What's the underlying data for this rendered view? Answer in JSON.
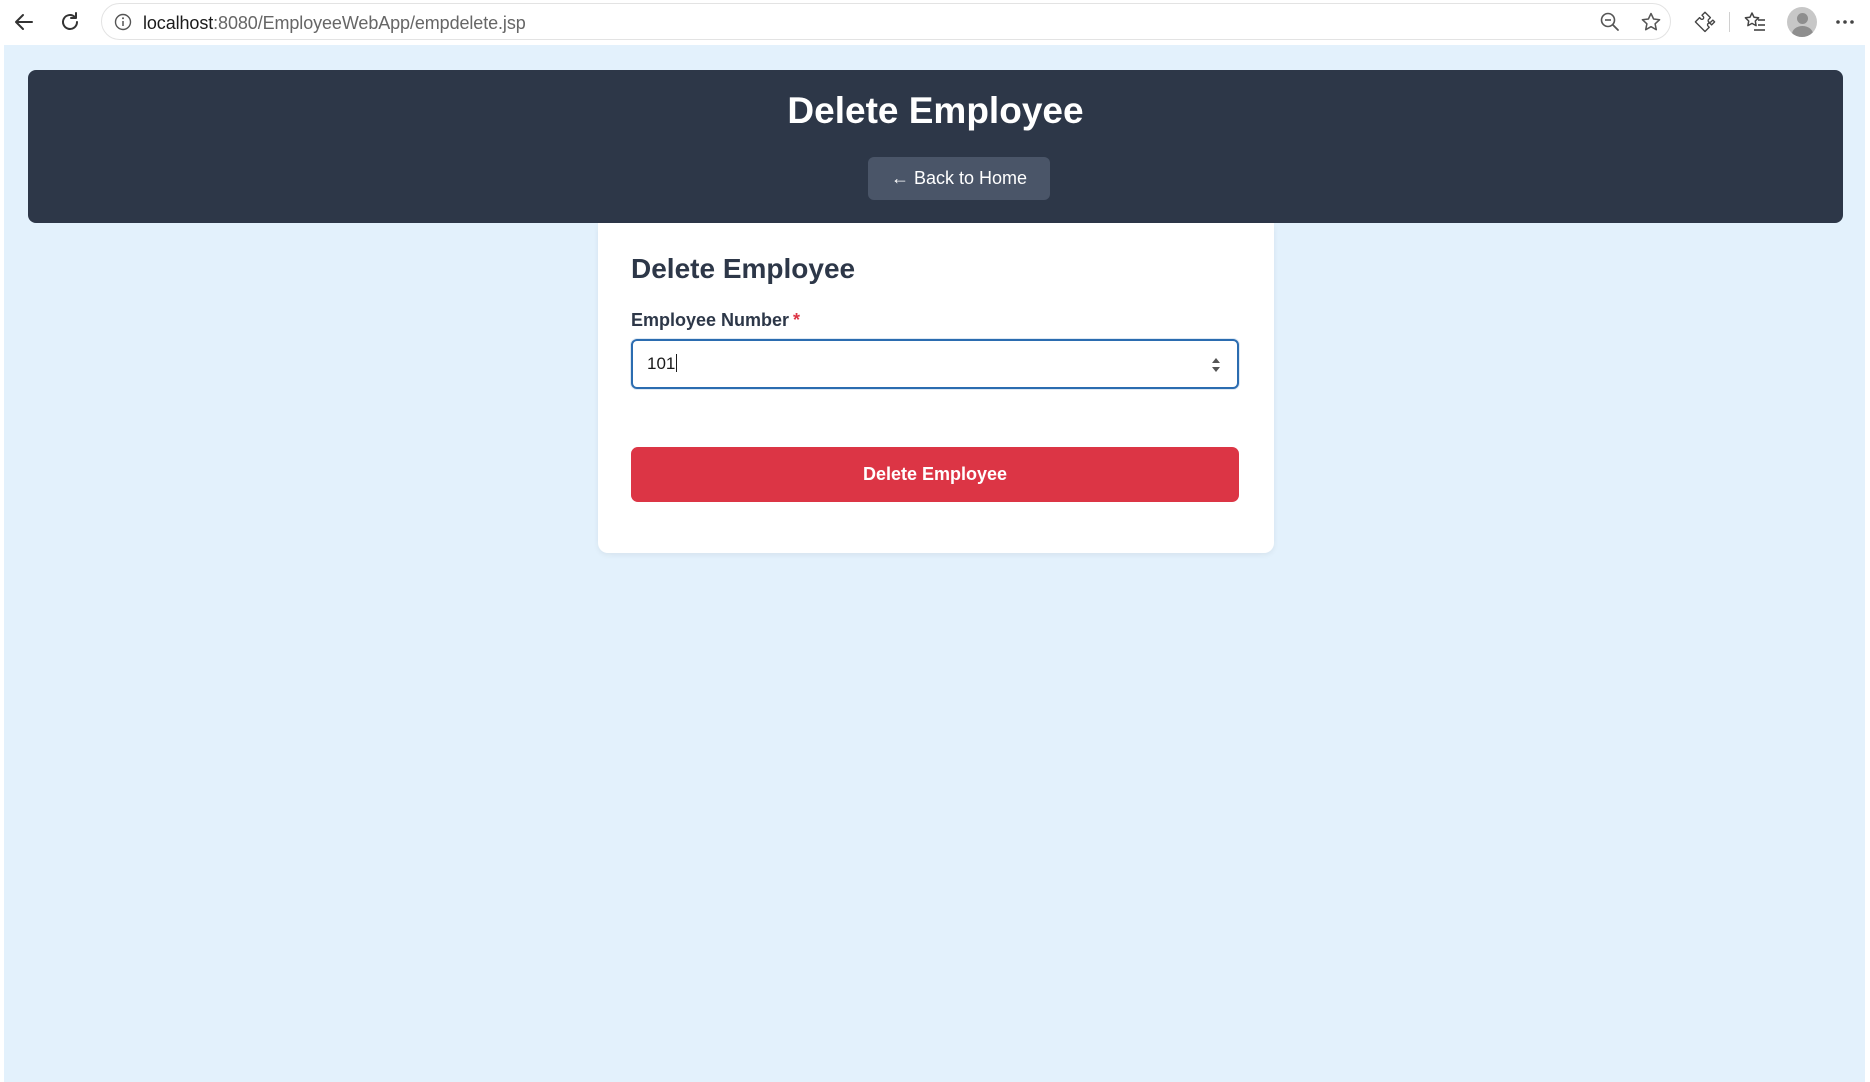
{
  "browser": {
    "url_host": "localhost",
    "url_path": ":8080/EmployeeWebApp/empdelete.jsp"
  },
  "header": {
    "title": "Delete Employee",
    "back_label": "← Back to Home"
  },
  "form": {
    "title": "Delete Employee",
    "employee_number_label": "Employee Number",
    "required_marker": "*",
    "employee_number_value": "101",
    "submit_label": "Delete Employee"
  },
  "colors": {
    "header_bg": "#2d3748",
    "page_bg": "#e3f1fc",
    "danger": "#dc3545",
    "focus": "#2b6cb0"
  }
}
